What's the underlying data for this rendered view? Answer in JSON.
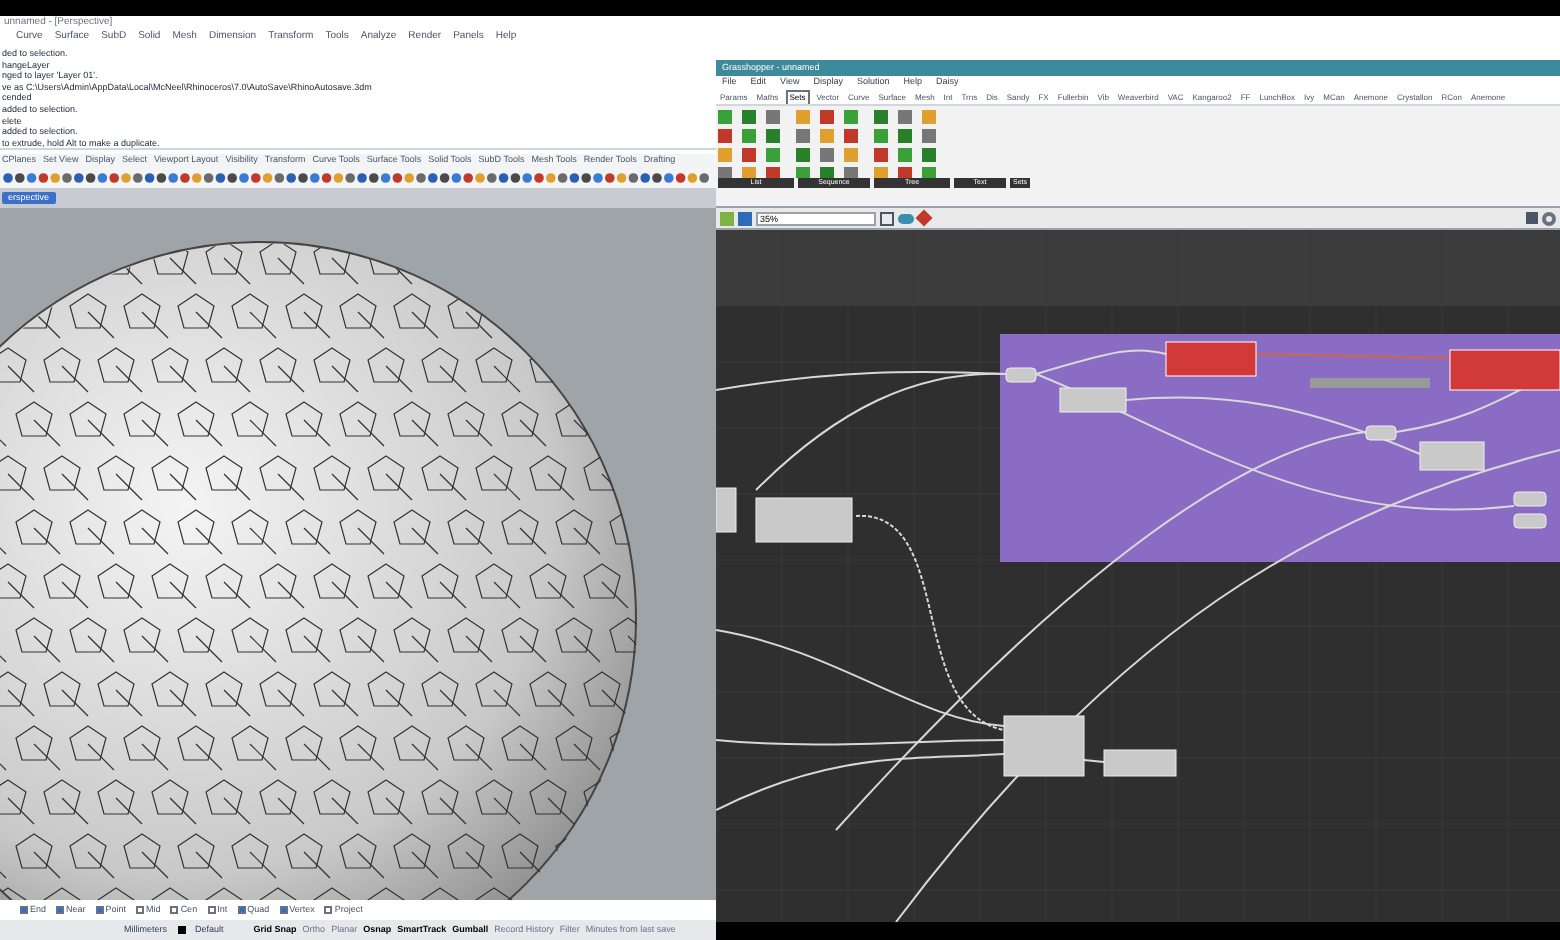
{
  "rhino": {
    "title": "unnamed - [Perspective]",
    "menus": [
      "Curve",
      "Surface",
      "SubD",
      "Solid",
      "Mesh",
      "Dimension",
      "Transform",
      "Tools",
      "Analyze",
      "Render",
      "Panels",
      "Help"
    ],
    "command_history": [
      "ded to selection.",
      "hangeLayer",
      "nged to layer 'Layer 01'.",
      "ve as C:\\Users\\Admin\\AppData\\Local\\McNeel\\Rhinoceros\\7.0\\AutoSave\\RhinoAutosave.3dm",
      "cended",
      "added to selection.",
      "elete",
      "added to selection.",
      "to extrude, hold Alt to make a duplicate."
    ],
    "toolbar_tabs": [
      "CPlanes",
      "Set View",
      "Display",
      "Select",
      "Viewport Layout",
      "Visibility",
      "Transform",
      "Curve Tools",
      "Surface Tools",
      "Solid Tools",
      "SubD Tools",
      "Mesh Tools",
      "Render Tools",
      "Drafting"
    ],
    "viewport_tab": "erspective",
    "osnaps": [
      {
        "label": "End",
        "checked": true
      },
      {
        "label": "Near",
        "checked": true
      },
      {
        "label": "Point",
        "checked": true
      },
      {
        "label": "Mid",
        "checked": false
      },
      {
        "label": "Cen",
        "checked": false
      },
      {
        "label": "Int",
        "checked": false
      },
      {
        "label": "Quad",
        "checked": true
      },
      {
        "label": "Vertex",
        "checked": true
      },
      {
        "label": "Project",
        "checked": false
      }
    ],
    "status_bar": {
      "units": "Millimeters",
      "layer": "Default",
      "toggles": [
        {
          "label": "Grid Snap",
          "on": true
        },
        {
          "label": "Ortho",
          "on": false
        },
        {
          "label": "Planar",
          "on": false
        },
        {
          "label": "Osnap",
          "on": true
        },
        {
          "label": "SmartTrack",
          "on": true
        },
        {
          "label": "Gumball",
          "on": true
        },
        {
          "label": "Record History",
          "on": false
        },
        {
          "label": "Filter",
          "on": false
        },
        {
          "label": "Minutes from last save",
          "on": false
        }
      ]
    }
  },
  "grasshopper": {
    "title": "Grasshopper - unnamed",
    "menus": [
      "File",
      "Edit",
      "View",
      "Display",
      "Solution",
      "Help",
      "Daisy"
    ],
    "tabs": [
      {
        "label": "Params",
        "selected": false
      },
      {
        "label": "Maths",
        "selected": false
      },
      {
        "label": "Sets",
        "selected": true
      },
      {
        "label": "Vector",
        "selected": false
      },
      {
        "label": "Curve",
        "selected": false
      },
      {
        "label": "Surface",
        "selected": false
      },
      {
        "label": "Mesh",
        "selected": false
      },
      {
        "label": "Int",
        "selected": false
      },
      {
        "label": "Trns",
        "selected": false
      },
      {
        "label": "Dis",
        "selected": false
      },
      {
        "label": "Sandy",
        "selected": false
      },
      {
        "label": "FX",
        "selected": false
      },
      {
        "label": "Fullerbin",
        "selected": false
      },
      {
        "label": "Vib",
        "selected": false
      },
      {
        "label": "Weaverbird",
        "selected": false
      },
      {
        "label": "VAC",
        "selected": false
      },
      {
        "label": "Kangaroo2",
        "selected": false
      },
      {
        "label": "FF",
        "selected": false
      },
      {
        "label": "LunchBox",
        "selected": false
      },
      {
        "label": "Ivy",
        "selected": false
      },
      {
        "label": "MCan",
        "selected": false
      },
      {
        "label": "Anemone",
        "selected": false
      },
      {
        "label": "Crystallon",
        "selected": false
      },
      {
        "label": "RCon",
        "selected": false
      },
      {
        "label": "Anemone",
        "selected": false
      }
    ],
    "panel_groups": [
      "List",
      "Sequence",
      "Tree",
      "Text",
      "Sets"
    ],
    "zoom": "35%"
  }
}
